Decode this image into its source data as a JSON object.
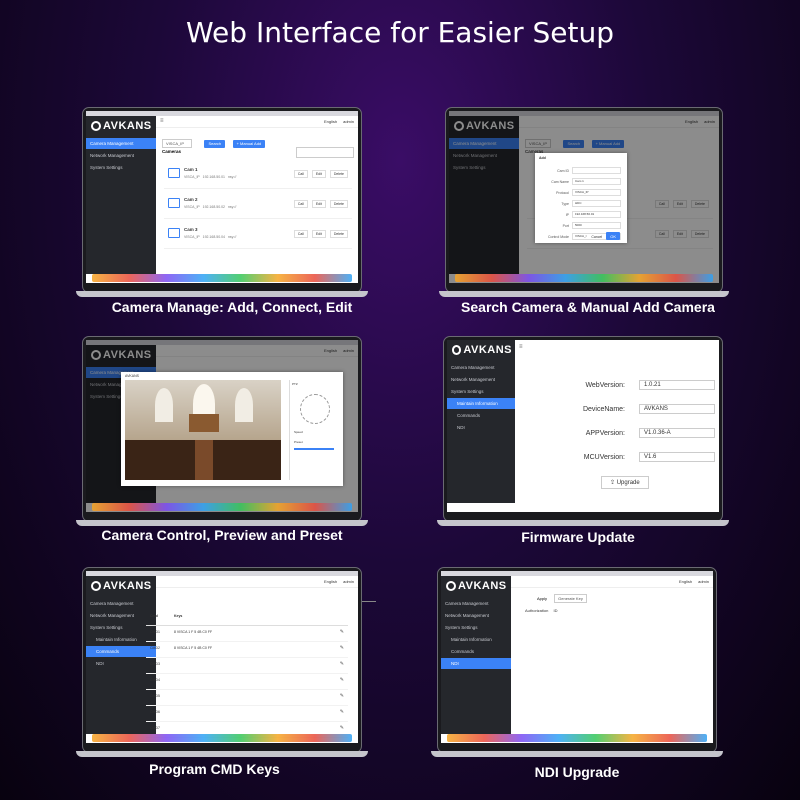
{
  "headline": "Web Interface for Easier Setup",
  "brand": "AVKANS",
  "nav": {
    "camera_management": "Camera Management",
    "network_management": "Network Management",
    "system_settings": "System Settings",
    "maintain_information": "Maintain Information",
    "commands": "Commands",
    "ndi": "NDI"
  },
  "topbar": {
    "language": "English",
    "user": "admin"
  },
  "panel1": {
    "caption": "Camera Manage: Add, Connect, Edit",
    "search_value": "VISCA_IP",
    "search_button": "Search",
    "manual_add_button": "+ Manual Add",
    "cameras_label": "Cameras",
    "cameras": [
      {
        "name": "Cam 1",
        "protocol": "VISCA_IP",
        "ip": "192.168.50.01",
        "extra": "nsy://"
      },
      {
        "name": "Cam 2",
        "protocol": "VISCA_IP",
        "ip": "192.168.50.02",
        "extra": "nsy://"
      },
      {
        "name": "Cam 3",
        "protocol": "VISCA_IP",
        "ip": "192.168.50.04",
        "extra": "nsy://"
      }
    ],
    "call": "Call",
    "edit": "Edit",
    "delete": "Delete"
  },
  "panel2": {
    "caption": "Search Camera & Manual Add Camera",
    "dialog_title": "Add",
    "fields": [
      {
        "label": "Cam ID",
        "value": "",
        "placeholder": ""
      },
      {
        "label": "Cam Name",
        "value": "Cam 1"
      },
      {
        "label": "Protocol",
        "value": "VISCA_IP"
      },
      {
        "label": "Type",
        "value": "HDC"
      },
      {
        "label": "IP",
        "value": "192.168.50.01"
      },
      {
        "label": "Port",
        "value": "5000"
      },
      {
        "label": "Control Mode",
        "value": "VISCA_I"
      }
    ],
    "cancel": "Cancel",
    "ok": "OK"
  },
  "panel3": {
    "caption": "Camera Control, Preview and Preset",
    "dialog_title": "AVKANS",
    "control_tabs": "PTZ",
    "preset_label": "Preset",
    "speed_label": "Speed"
  },
  "panel4": {
    "caption": "Firmware Update",
    "rows": [
      {
        "label": "WebVersion:",
        "value": "1.0.21"
      },
      {
        "label": "DeviceName:",
        "value": "AVKANS"
      },
      {
        "label": "APPVersion:",
        "value": "V1.0.36-A"
      },
      {
        "label": "MCUVersion:",
        "value": "V1.6"
      }
    ],
    "upgrade": "Upgrade"
  },
  "panel5": {
    "caption": "Program CMD Keys",
    "col_cmd": "Cmd",
    "col_keys": "Keys",
    "rows": [
      {
        "cmd": "CMD1",
        "keys": "8 VISCA 1 F 5 4B C0 FF"
      },
      {
        "cmd": "CMD2",
        "keys": "8 VISCA 1 F 5 4B C0 FF"
      },
      {
        "cmd": "CMD3",
        "keys": ""
      },
      {
        "cmd": "CMD4",
        "keys": ""
      },
      {
        "cmd": "CMD5",
        "keys": ""
      },
      {
        "cmd": "CMD6",
        "keys": ""
      },
      {
        "cmd": "CMD7",
        "keys": ""
      }
    ]
  },
  "panel6": {
    "caption": "NDI Upgrade",
    "apply": "Apply",
    "generate_key": "Generate Key",
    "authorization_label": "Authorization",
    "authorization_value": "ID"
  }
}
